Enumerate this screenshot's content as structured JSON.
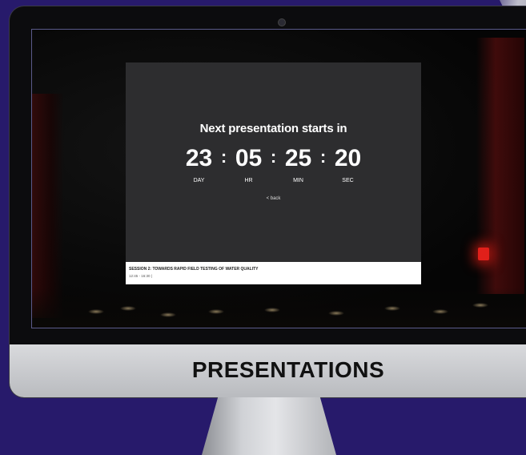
{
  "presentation": {
    "heading": "Next presentation starts in",
    "countdown": {
      "day": "23",
      "hr": "05",
      "min": "25",
      "sec": "20",
      "separator": ":",
      "labels": {
        "day": "DAY",
        "hr": "HR",
        "min": "MIN",
        "sec": "SEC"
      }
    },
    "back_link": "< back",
    "session": {
      "title": "SESSION 2: TOWARDS RAPID FIELD TESTING OF WATER QUALITY",
      "time": "12:45 - 16:30 |"
    }
  },
  "banner": {
    "title": "PRESENTATIONS"
  },
  "colors": {
    "background": "#271a6b",
    "panel": "#2d2d2f",
    "chin": "#c9cacd",
    "exit_light": "#e0201a"
  }
}
